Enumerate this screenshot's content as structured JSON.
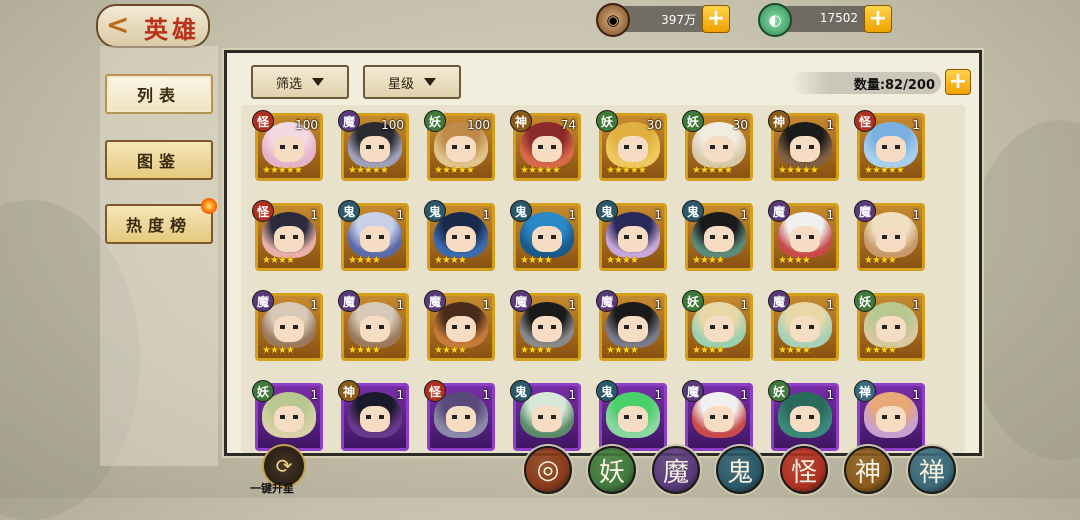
{
  "header": {
    "title": "英雄",
    "back_icon": "chevron-left-icon",
    "resources": [
      {
        "icon": "coin-icon",
        "value": "397万",
        "color": "#8a5a2a"
      },
      {
        "icon": "jade-icon",
        "value": "17502",
        "color": "#2e8a52"
      }
    ]
  },
  "sidebar": {
    "items": [
      {
        "label": "列表",
        "active": true
      },
      {
        "label": "图鉴",
        "active": false
      },
      {
        "label": "热度榜",
        "active": false,
        "badge": "fire-icon"
      }
    ]
  },
  "toolbar": {
    "filter_label": "筛选",
    "star_label": "星级",
    "count_label": "数量:82/200"
  },
  "tribe_colors": {
    "妖": "#3f7a3a",
    "魔": "#5a3a7a",
    "神": "#8a5a1a",
    "鬼": "#2a5a6a",
    "怪": "#b03020",
    "禅": "#3a6a7a"
  },
  "heroes": [
    {
      "tribe": "怪",
      "level": "100",
      "stars": 5,
      "frame": "gold",
      "hair": "#f3d9e2",
      "bg": "#e6b3c8"
    },
    {
      "tribe": "魔",
      "level": "100",
      "stars": 5,
      "frame": "gold",
      "hair": "#2a2a30",
      "bg": "#a0a0b8"
    },
    {
      "tribe": "妖",
      "level": "100",
      "stars": 5,
      "frame": "gold",
      "hair": "#c08a4a",
      "bg": "#e0c48a"
    },
    {
      "tribe": "神",
      "level": "74",
      "stars": 5,
      "frame": "gold",
      "hair": "#8a2a2a",
      "bg": "#d86a4a"
    },
    {
      "tribe": "妖",
      "level": "30",
      "stars": 5,
      "frame": "gold",
      "hair": "#e0b040",
      "bg": "#f0c860"
    },
    {
      "tribe": "妖",
      "level": "30",
      "stars": 5,
      "frame": "gold",
      "hair": "#f0ece0",
      "bg": "#d8c8a8"
    },
    {
      "tribe": "神",
      "level": "1",
      "stars": 5,
      "frame": "gold",
      "hair": "#1a1a1a",
      "bg": "#806040"
    },
    {
      "tribe": "怪",
      "level": "1",
      "stars": 5,
      "frame": "gold",
      "hair": "#7ab0e0",
      "bg": "#a8d0f0"
    },
    {
      "tribe": "怪",
      "level": "1",
      "stars": 4,
      "frame": "gold",
      "hair": "#2a2a3a",
      "bg": "#e8b0a8"
    },
    {
      "tribe": "鬼",
      "level": "1",
      "stars": 4,
      "frame": "gold",
      "hair": "#c8d0e8",
      "bg": "#5a6aa8"
    },
    {
      "tribe": "鬼",
      "level": "1",
      "stars": 4,
      "frame": "gold",
      "hair": "#1a2a4a",
      "bg": "#3a6ab0"
    },
    {
      "tribe": "鬼",
      "level": "1",
      "stars": 4,
      "frame": "gold",
      "hair": "#2a8ac8",
      "bg": "#1a5a8a"
    },
    {
      "tribe": "鬼",
      "level": "1",
      "stars": 4,
      "frame": "gold",
      "hair": "#2a2a5a",
      "bg": "#c8a8d8"
    },
    {
      "tribe": "鬼",
      "level": "1",
      "stars": 4,
      "frame": "gold",
      "hair": "#1a1a1a",
      "bg": "#5a8a7a"
    },
    {
      "tribe": "魔",
      "level": "1",
      "stars": 4,
      "frame": "gold",
      "hair": "#f0f0f0",
      "bg": "#c84a4a"
    },
    {
      "tribe": "魔",
      "level": "1",
      "stars": 4,
      "frame": "gold",
      "hair": "#f0e0c0",
      "bg": "#c89a6a"
    },
    {
      "tribe": "魔",
      "level": "1",
      "stars": 4,
      "frame": "gold",
      "hair": "#d8c8b8",
      "bg": "#9a7a5a"
    },
    {
      "tribe": "魔",
      "level": "1",
      "stars": 4,
      "frame": "gold",
      "hair": "#d8c8b8",
      "bg": "#9a7a5a"
    },
    {
      "tribe": "魔",
      "level": "1",
      "stars": 4,
      "frame": "gold",
      "hair": "#4a2a1a",
      "bg": "#c87a3a"
    },
    {
      "tribe": "魔",
      "level": "1",
      "stars": 4,
      "frame": "gold",
      "hair": "#1a1a1a",
      "bg": "#8a8a8a"
    },
    {
      "tribe": "魔",
      "level": "1",
      "stars": 4,
      "frame": "gold",
      "hair": "#1a1a1a",
      "bg": "#7a7a8a"
    },
    {
      "tribe": "妖",
      "level": "1",
      "stars": 4,
      "frame": "gold",
      "hair": "#e8d8a8",
      "bg": "#9ad0b0"
    },
    {
      "tribe": "魔",
      "level": "1",
      "stars": 4,
      "frame": "gold",
      "hair": "#e8d8a8",
      "bg": "#a8d0b8"
    },
    {
      "tribe": "妖",
      "level": "1",
      "stars": 4,
      "frame": "gold",
      "hair": "#b8c890",
      "bg": "#d8c8a0"
    },
    {
      "tribe": "妖",
      "level": "1",
      "stars": 0,
      "frame": "purple",
      "hair": "#b8c890",
      "bg": "#d8d0a8"
    },
    {
      "tribe": "神",
      "level": "1",
      "stars": 0,
      "frame": "purple",
      "hair": "#1a1a2a",
      "bg": "#6a3a8a"
    },
    {
      "tribe": "怪",
      "level": "1",
      "stars": 0,
      "frame": "purple",
      "hair": "#5a4a7a",
      "bg": "#8a8aa8"
    },
    {
      "tribe": "鬼",
      "level": "1",
      "stars": 0,
      "frame": "purple",
      "hair": "#d8e8d8",
      "bg": "#5a8a6a"
    },
    {
      "tribe": "鬼",
      "level": "1",
      "stars": 0,
      "frame": "purple",
      "hair": "#4ad06a",
      "bg": "#8ad8a0"
    },
    {
      "tribe": "魔",
      "level": "1",
      "stars": 0,
      "frame": "purple",
      "hair": "#f0f0f0",
      "bg": "#c84a4a"
    },
    {
      "tribe": "妖",
      "level": "1",
      "stars": 0,
      "frame": "purple",
      "hair": "#2a6a5a",
      "bg": "#3a8a7a"
    },
    {
      "tribe": "禅",
      "level": "1",
      "stars": 0,
      "frame": "purple",
      "hair": "#e8a878",
      "bg": "#c8a0d0"
    }
  ],
  "bottom": {
    "one_key_label": "一键升星",
    "factions": [
      {
        "label": "◎",
        "color": "#8a3a1a",
        "name": "all"
      },
      {
        "label": "妖",
        "color": "#3f7a3a",
        "name": "yao"
      },
      {
        "label": "魔",
        "color": "#5a3a7a",
        "name": "mo"
      },
      {
        "label": "鬼",
        "color": "#2a5a6a",
        "name": "gui"
      },
      {
        "label": "怪",
        "color": "#b03020",
        "name": "guai"
      },
      {
        "label": "神",
        "color": "#8a5a1a",
        "name": "shen"
      },
      {
        "label": "禅",
        "color": "#3a6a7a",
        "name": "chan"
      }
    ]
  }
}
